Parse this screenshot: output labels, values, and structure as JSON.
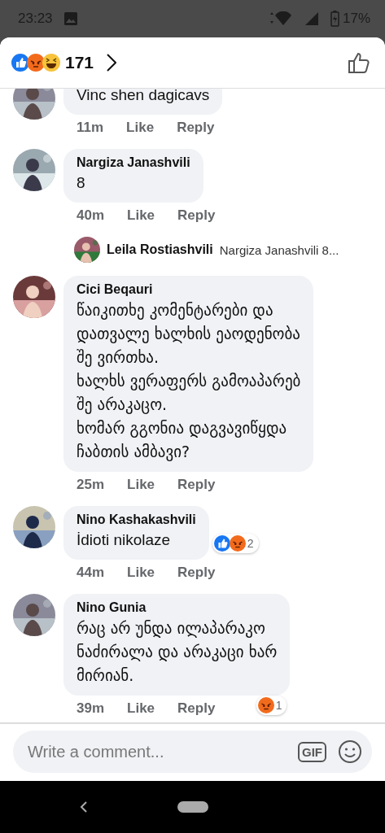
{
  "status_bar": {
    "time": "23:23",
    "battery": "17%"
  },
  "header": {
    "reactions": [
      {
        "kind": "like"
      },
      {
        "kind": "angry"
      },
      {
        "kind": "haha"
      }
    ],
    "count": "171"
  },
  "comments": [
    {
      "kind": "comment",
      "text": "Vinc shen dagicavs",
      "time": "11m",
      "like": "Like",
      "reply": "Reply",
      "partial": true
    },
    {
      "kind": "comment",
      "name": "Nargiza Janashvili",
      "text": "8",
      "time": "40m",
      "like": "Like",
      "reply": "Reply"
    },
    {
      "kind": "reply_preview",
      "name": "Leila Rostiashvili",
      "text": "Nargiza Janashvili 8..."
    },
    {
      "kind": "comment",
      "name": "Cici Beqauri",
      "text": "წაიკითხე კომენტარები და\nდათვალე ხალხის ეაოდენობა\nშე ვირთხა.\nხალხს ვერაფერს გამოაპარებ\nშე არაკაცო.\nხომარ გგონია დაგვავიწყდა\nჩაბთის ამბავი?",
      "time": "25m",
      "like": "Like",
      "reply": "Reply"
    },
    {
      "kind": "comment",
      "name": "Nino Kashakashvili",
      "text": "İdioti nikolaze",
      "time": "44m",
      "like": "Like",
      "reply": "Reply",
      "reactions": {
        "kind": "side",
        "icons": [
          {
            "kind": "like"
          },
          {
            "kind": "angry"
          }
        ],
        "count": "2"
      }
    },
    {
      "kind": "comment",
      "name": "Nino Gunia",
      "text": "რაც არ უნდა ილაპარაკო\nნაძირალა და არაკაცი ხარ\nმირიან.",
      "time": "39m",
      "like": "Like",
      "reply": "Reply",
      "reactions": {
        "kind": "below",
        "icons": [
          {
            "kind": "angry"
          }
        ],
        "count": "1"
      }
    }
  ],
  "composer": {
    "placeholder": "Write a comment...",
    "gif": "GIF"
  }
}
